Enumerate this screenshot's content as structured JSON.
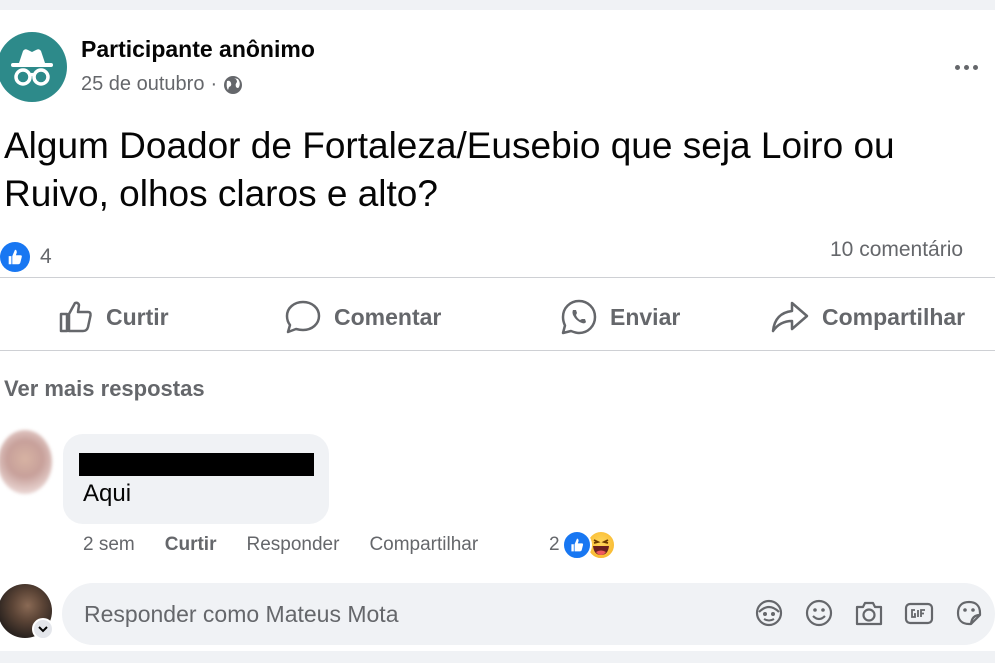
{
  "post": {
    "author": "Participante anônimo",
    "date": "25 de outubro",
    "meta_separator": "·",
    "privacy_icon": "globe-icon",
    "text": "Algum Doador de Fortaleza/Eusebio que seja Loiro ou Ruivo, olhos claros e alto?",
    "reaction_count": "4",
    "comments_count": "10 comentário",
    "more_icon": "more-options-icon"
  },
  "actions": {
    "like": "Curtir",
    "comment": "Comentar",
    "send": "Enviar",
    "share": "Compartilhar"
  },
  "replies": {
    "see_more": "Ver mais respostas"
  },
  "comment": {
    "text": "Aqui",
    "time": "2 sem",
    "like": "Curtir",
    "reply": "Responder",
    "share": "Compartilhar",
    "reaction_count": "2",
    "author_redacted": true
  },
  "reply_box": {
    "placeholder": "Responder como Mateus Mota",
    "icons": [
      "avatar-sticker-icon",
      "emoji-icon",
      "camera-icon",
      "gif-icon",
      "sticker-icon"
    ]
  },
  "colors": {
    "accent": "#1877f2",
    "anon_avatar": "#2d8a8a",
    "secondary_text": "#65676b",
    "bubble": "#f0f2f5"
  }
}
